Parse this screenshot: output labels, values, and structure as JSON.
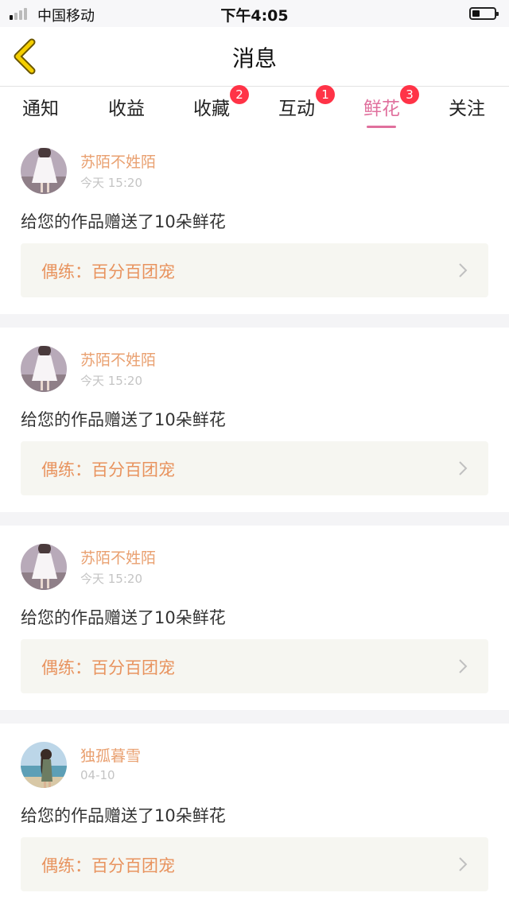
{
  "status_bar": {
    "carrier": "中国移动",
    "time": "下午4:05"
  },
  "nav": {
    "title": "消息"
  },
  "tabs": [
    {
      "label": "通知",
      "badge": ""
    },
    {
      "label": "收益",
      "badge": ""
    },
    {
      "label": "收藏",
      "badge": "2"
    },
    {
      "label": "互动",
      "badge": "1"
    },
    {
      "label": "鲜花",
      "badge": "3",
      "active": true
    },
    {
      "label": "关注",
      "badge": ""
    }
  ],
  "messages": [
    {
      "user": "苏陌不姓陌",
      "time": "今天 15:20",
      "text": "给您的作品赠送了10朵鲜花",
      "work": "偶练：百分百团宠",
      "avatar": "girl-in-white-dress"
    },
    {
      "user": "苏陌不姓陌",
      "time": "今天 15:20",
      "text": "给您的作品赠送了10朵鲜花",
      "work": "偶练：百分百团宠",
      "avatar": "girl-in-white-dress"
    },
    {
      "user": "苏陌不姓陌",
      "time": "今天 15:20",
      "text": "给您的作品赠送了10朵鲜花",
      "work": "偶练：百分百团宠",
      "avatar": "girl-in-white-dress"
    },
    {
      "user": "独孤暮雪",
      "time": "04-10",
      "text": "给您的作品赠送了10朵鲜花",
      "work": "偶练：百分百团宠",
      "avatar": "girl-at-beach"
    }
  ],
  "colors": {
    "accent": "#e0709d",
    "username": "#e9a070",
    "work_text": "#e8935e",
    "badge": "#ff3347",
    "back_arrow": "#e6c000"
  }
}
